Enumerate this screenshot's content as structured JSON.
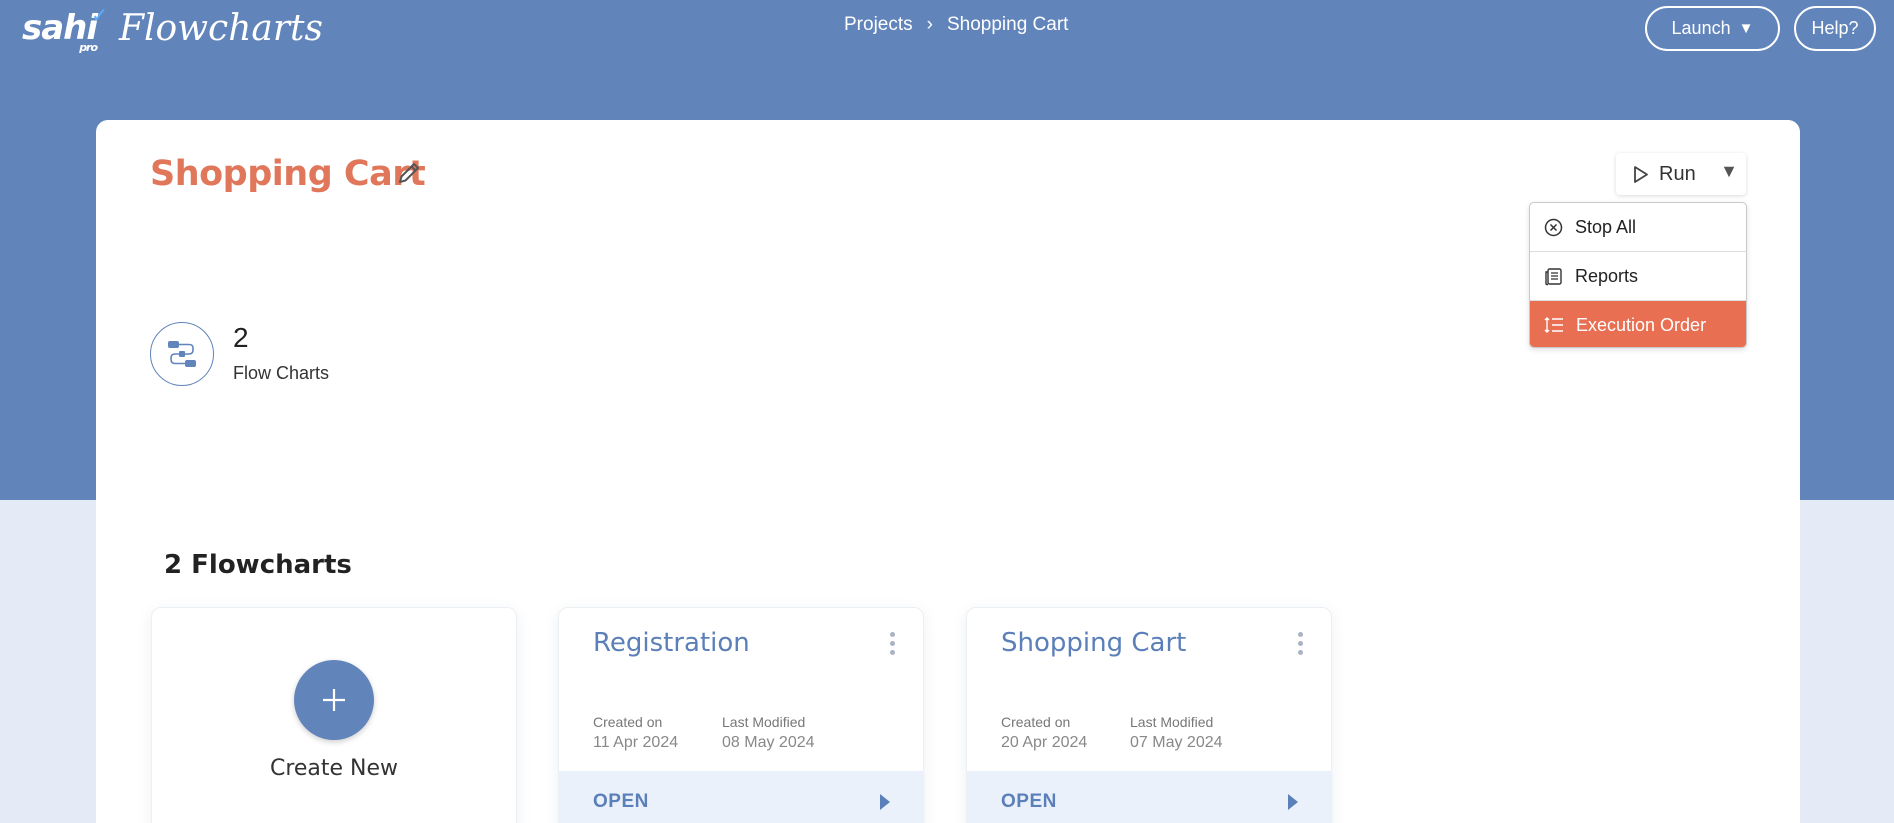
{
  "colors": {
    "header_blue": "#6184bb",
    "accent_orange": "#e0775a",
    "active_item": "#e86f51",
    "link_blue": "#5b7fb8",
    "page_bg": "#e4ebf6"
  },
  "header": {
    "logo_brand": "sahi",
    "logo_tier": "pro",
    "logo_product": "Flowcharts",
    "breadcrumb": {
      "root": "Projects",
      "separator": "›",
      "current": "Shopping Cart"
    },
    "launch_label": "Launch",
    "help_label": "Help?"
  },
  "project": {
    "title": "Shopping Cart",
    "edit_icon": "pencil-icon"
  },
  "run_menu": {
    "run_label": "Run",
    "items": [
      {
        "label": "Stop All",
        "icon": "stop-circle-icon",
        "active": false
      },
      {
        "label": "Reports",
        "icon": "reports-icon",
        "active": false
      },
      {
        "label": "Execution Order",
        "icon": "execution-order-icon",
        "active": true
      }
    ]
  },
  "stats": {
    "count": "2",
    "label": "Flow Charts",
    "icon": "flowchart-icon"
  },
  "flowcharts": {
    "section_title": "2 Flowcharts",
    "create_label": "Create New",
    "items": [
      {
        "name": "Registration",
        "created_label": "Created on",
        "created": "11 Apr 2024",
        "modified_label": "Last Modified",
        "modified": "08 May 2024",
        "open_label": "OPEN"
      },
      {
        "name": "Shopping Cart",
        "created_label": "Created on",
        "created": "20 Apr 2024",
        "modified_label": "Last Modified",
        "modified": "07 May 2024",
        "open_label": "OPEN"
      }
    ]
  }
}
